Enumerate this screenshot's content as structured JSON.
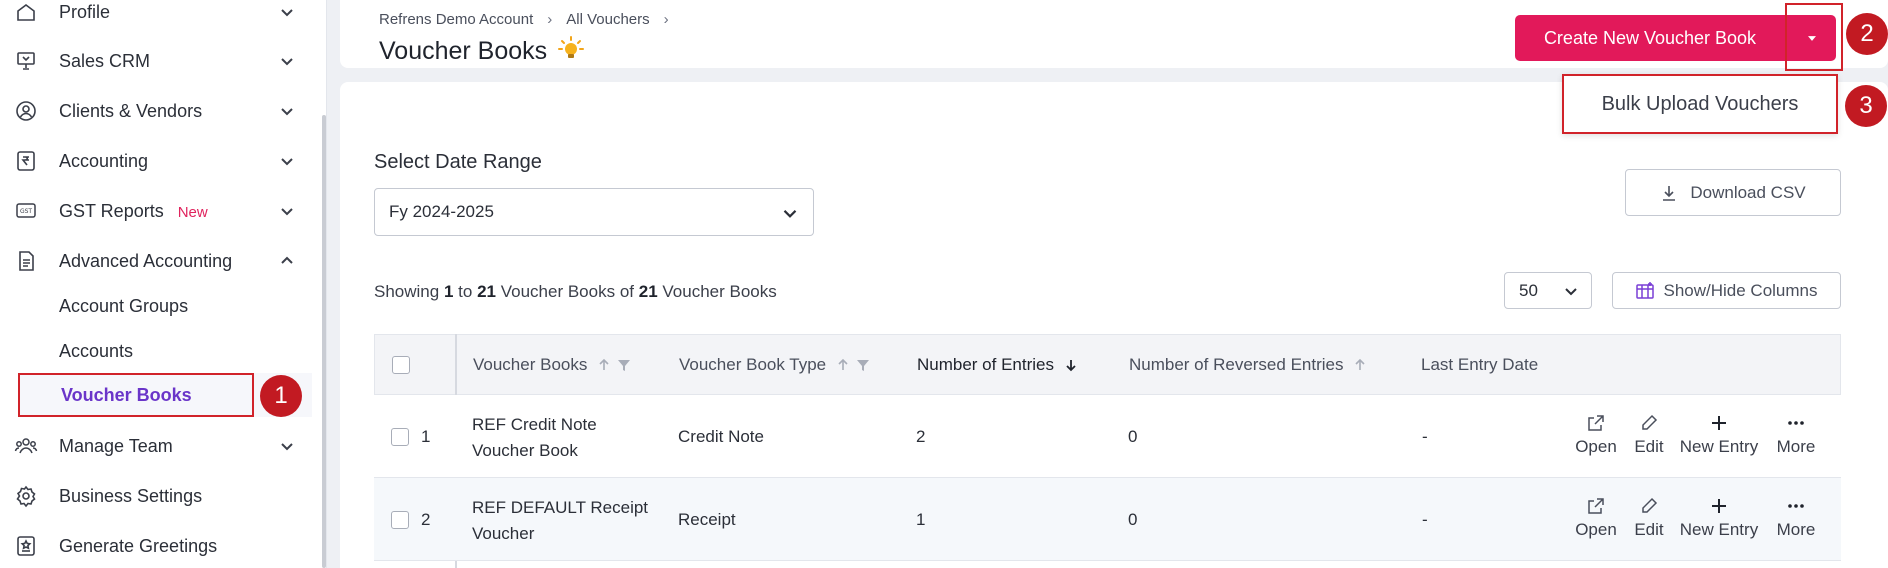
{
  "sidebar": {
    "items": [
      {
        "label": "Profile",
        "icon": "home-icon"
      },
      {
        "label": "Sales CRM",
        "icon": "presentation-icon"
      },
      {
        "label": "Clients & Vendors",
        "icon": "user-circle-icon"
      },
      {
        "label": "Accounting",
        "icon": "rupee-icon"
      },
      {
        "label": "GST Reports",
        "icon": "gst-icon",
        "badge": "New"
      },
      {
        "label": "Advanced Accounting",
        "icon": "document-icon"
      },
      {
        "label": "Manage Team",
        "icon": "team-icon"
      },
      {
        "label": "Business Settings",
        "icon": "gear-icon"
      },
      {
        "label": "Generate Greetings",
        "icon": "greeting-card-icon"
      }
    ],
    "sub_items": [
      "Account Groups",
      "Accounts",
      "Voucher Books"
    ]
  },
  "header": {
    "breadcrumbs": [
      "Refrens Demo Account",
      "All Vouchers"
    ],
    "title": "Voucher Books",
    "create_button": "Create New Voucher Book"
  },
  "dropdown": {
    "bulk_upload": "Bulk Upload Vouchers"
  },
  "annotations": [
    "1",
    "2",
    "3"
  ],
  "filters": {
    "date_range_label": "Select Date Range",
    "date_range_value": "Fy 2024-2025",
    "download_csv": "Download CSV",
    "page_size": "50",
    "show_hide_columns": "Show/Hide Columns"
  },
  "summary": {
    "showing": "Showing",
    "from": "1",
    "to_word": "to",
    "to": "21",
    "noun1": "Voucher Books",
    "of_word": "of",
    "total": "21",
    "noun2": "Voucher Books"
  },
  "table": {
    "columns": [
      "Voucher Books",
      "Voucher Book Type",
      "Number of Entries",
      "Number of Reversed Entries",
      "Last Entry Date"
    ],
    "rows": [
      {
        "index": "1",
        "name": "REF Credit Note Voucher Book",
        "type": "Credit Note",
        "entries": "2",
        "reversed": "0",
        "last": "-"
      },
      {
        "index": "2",
        "name": "REF DEFAULT Receipt Voucher",
        "type": "Receipt",
        "entries": "1",
        "reversed": "0",
        "last": "-"
      }
    ],
    "actions": [
      "Open",
      "Edit",
      "New Entry",
      "More"
    ]
  },
  "colors": {
    "primary": "#e2195a",
    "annotation": "#c21a22",
    "active_nav": "#6a35c9",
    "new_badge": "#e0245e"
  }
}
